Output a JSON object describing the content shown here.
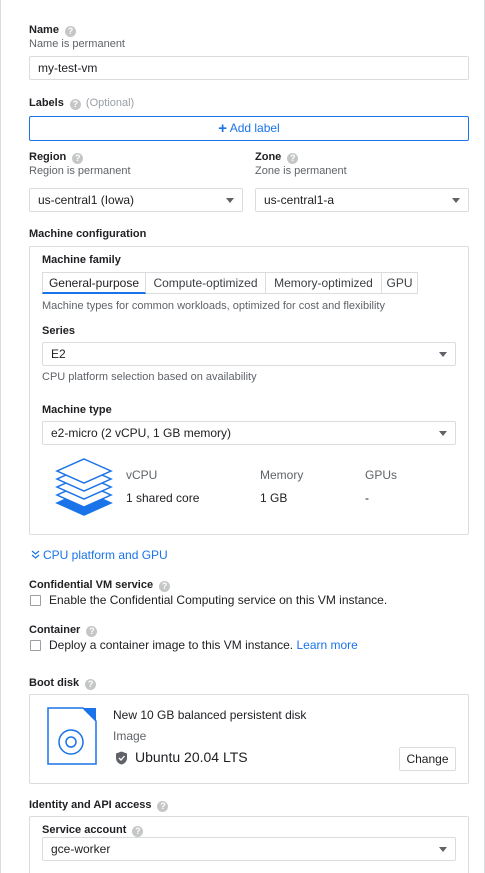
{
  "name": {
    "label": "Name",
    "sublabel": "Name is permanent",
    "value": "my-test-vm"
  },
  "labels": {
    "label": "Labels",
    "optional": "(Optional)",
    "add_button": "Add label"
  },
  "region": {
    "label": "Region",
    "sublabel": "Region is permanent",
    "value": "us-central1 (Iowa)"
  },
  "zone": {
    "label": "Zone",
    "sublabel": "Zone is permanent",
    "value": "us-central1-a"
  },
  "machine_config": {
    "heading": "Machine configuration",
    "family_label": "Machine family",
    "tabs": [
      "General-purpose",
      "Compute-optimized",
      "Memory-optimized",
      "GPU"
    ],
    "active_tab": "General-purpose",
    "family_description": "Machine types for common workloads, optimized for cost and flexibility",
    "series_label": "Series",
    "series_value": "E2",
    "series_hint": "CPU platform selection based on availability",
    "type_label": "Machine type",
    "type_value": "e2-micro (2 vCPU, 1 GB memory)",
    "specs": {
      "headers": [
        "vCPU",
        "Memory",
        "GPUs"
      ],
      "values": [
        "1 shared core",
        "1 GB",
        "-"
      ]
    }
  },
  "cpu_platform_link": "CPU platform and GPU",
  "confidential": {
    "label": "Confidential VM service",
    "checkbox_label": "Enable the Confidential Computing service on this VM instance.",
    "checked": false
  },
  "container": {
    "label": "Container",
    "checkbox_label": "Deploy a container image to this VM instance.",
    "learn_more": "Learn more",
    "checked": false
  },
  "boot_disk": {
    "label": "Boot disk",
    "title": "New 10 GB balanced persistent disk",
    "image_label": "Image",
    "image_value": "Ubuntu 20.04 LTS",
    "change_button": "Change"
  },
  "identity": {
    "label": "Identity and API access",
    "service_account_label": "Service account",
    "service_account_value": "gce-worker"
  },
  "colors": {
    "accent": "#1a73e8",
    "border": "#dadce0",
    "muted_text": "#5f6368"
  }
}
